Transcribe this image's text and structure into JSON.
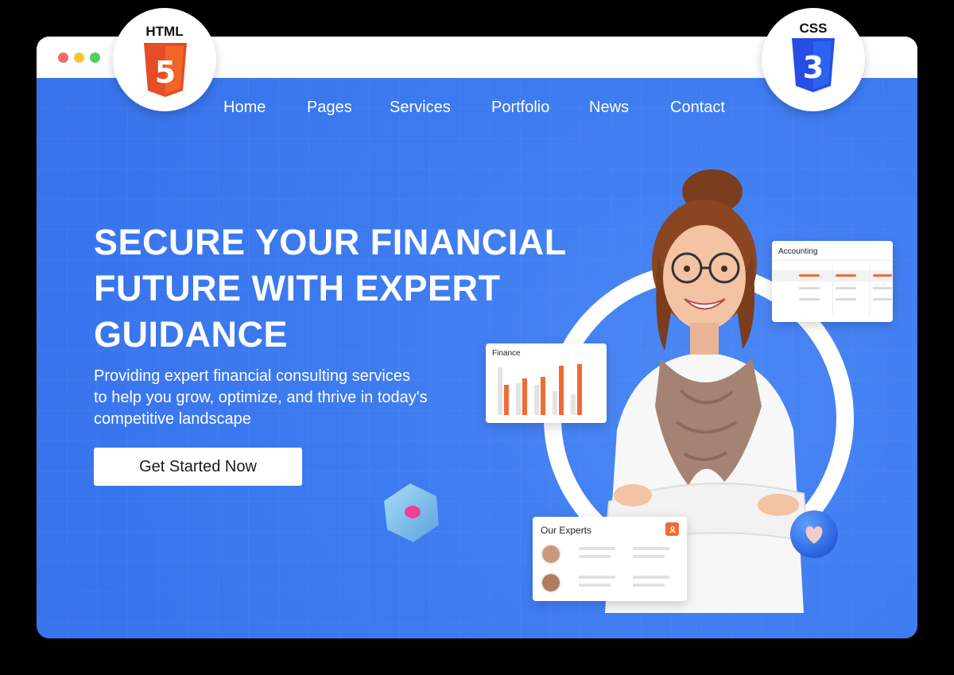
{
  "badges": {
    "html": {
      "label": "HTML",
      "shield_text": "5",
      "color": "#e44d26"
    },
    "css": {
      "label": "CSS",
      "shield_text": "3",
      "color": "#264de4"
    }
  },
  "nav": {
    "items": [
      "Home",
      "Pages",
      "Services",
      "Portfolio",
      "News",
      "Contact"
    ]
  },
  "hero": {
    "headline_lines": [
      "SECURE YOUR FINANCIAL",
      "FUTURE WITH EXPERT",
      "GUIDANCE"
    ],
    "subtext_lines": [
      "Providing expert financial consulting services",
      "to help you grow, optimize, and thrive in today's",
      "competitive landscape"
    ],
    "cta_label": "Get Started Now"
  },
  "cards": {
    "accounting": {
      "title": "Accounting"
    },
    "finance": {
      "title": "Finance"
    },
    "experts": {
      "title": "Our Experts"
    }
  },
  "colors": {
    "brand_blue": "#3d7bf0",
    "accent_orange": "#f26b35",
    "white": "#ffffff"
  }
}
